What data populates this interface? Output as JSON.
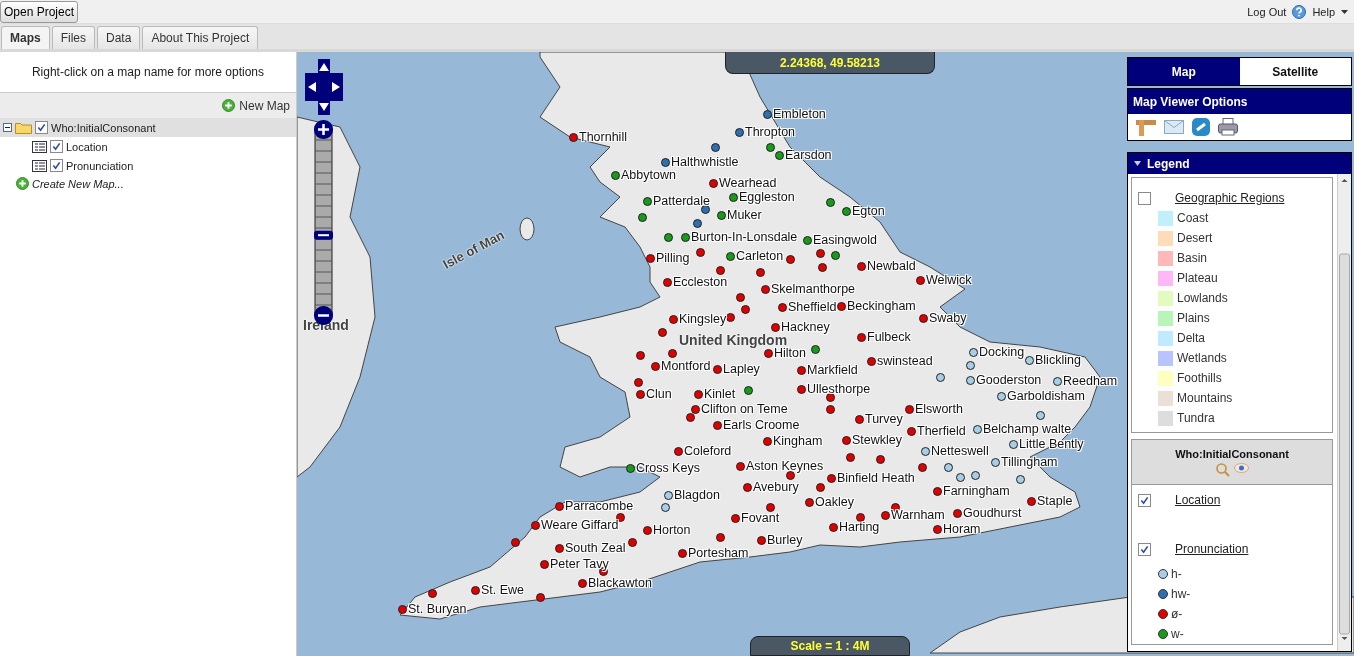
{
  "top_bar": {
    "open_button": "Open Project",
    "logout": "Log Out",
    "help": "Help"
  },
  "tabs": [
    {
      "label": "Maps",
      "selected": true
    },
    {
      "label": "Files",
      "selected": false
    },
    {
      "label": "Data",
      "selected": false
    },
    {
      "label": "About This Project",
      "selected": false
    }
  ],
  "left_panel": {
    "hint": "Right-click on a map name for more options",
    "new_map": "New Map",
    "tree": [
      {
        "label": "Who:InitialConsonant",
        "checked": true,
        "expanded": true,
        "children": [
          {
            "label": "Location",
            "checked": true
          },
          {
            "label": "Pronunciation",
            "checked": true
          }
        ]
      }
    ],
    "create_link": "Create New Map..."
  },
  "map": {
    "coordinates": "2.24368, 49.58213",
    "scale": "Scale = 1 : 4M",
    "zoom": {
      "level": 0.42
    },
    "region_labels": [
      {
        "label": "Isle of Man",
        "kind": "island"
      },
      {
        "label": "Ireland",
        "kind": "country"
      },
      {
        "label": "United Kingdom",
        "kind": "country"
      }
    ],
    "places": [
      {
        "name": "Thornhill",
        "color": "#e00000"
      },
      {
        "name": "Embleton",
        "color": "#2f6fae"
      },
      {
        "name": "Thropton",
        "color": "#2f6fae"
      },
      {
        "name": "Earsdon",
        "color": "#1a9a1a"
      },
      {
        "name": "Halthwhistle",
        "color": "#2f6fae"
      },
      {
        "name": "Abbytown",
        "color": "#1a9a1a"
      },
      {
        "name": "Wearhead",
        "color": "#e00000"
      },
      {
        "name": "Patterdale",
        "color": "#1a9a1a"
      },
      {
        "name": "Eggleston",
        "color": "#1a9a1a"
      },
      {
        "name": "Muker",
        "color": "#1a9a1a"
      },
      {
        "name": "Egton",
        "color": "#1a9a1a"
      },
      {
        "name": "Burton-In-Lonsdale",
        "color": "#1a9a1a"
      },
      {
        "name": "Easingwold",
        "color": "#1a9a1a"
      },
      {
        "name": "Pilling",
        "color": "#e00000"
      },
      {
        "name": "Carleton",
        "color": "#1a9a1a"
      },
      {
        "name": "Newbald",
        "color": "#e00000"
      },
      {
        "name": "Welwick",
        "color": "#e00000"
      },
      {
        "name": "Eccleston",
        "color": "#e00000"
      },
      {
        "name": "Skelmanthorpe",
        "color": "#e00000"
      },
      {
        "name": "Sheffield",
        "color": "#e00000"
      },
      {
        "name": "Beckingham",
        "color": "#e00000"
      },
      {
        "name": "Swaby",
        "color": "#e00000"
      },
      {
        "name": "Kingsley",
        "color": "#e00000"
      },
      {
        "name": "Hackney",
        "color": "#e00000"
      },
      {
        "name": "Fulbeck",
        "color": "#e00000"
      },
      {
        "name": "Hilton",
        "color": "#e00000"
      },
      {
        "name": "Montford",
        "color": "#e00000"
      },
      {
        "name": "Lapley",
        "color": "#e00000"
      },
      {
        "name": "Markfield",
        "color": "#e00000"
      },
      {
        "name": "swinstead",
        "color": "#e00000"
      },
      {
        "name": "Docking",
        "color": "#a8cde6"
      },
      {
        "name": "Blickling",
        "color": "#a8cde6"
      },
      {
        "name": "Gooderston",
        "color": "#a8cde6"
      },
      {
        "name": "Reedham",
        "color": "#a8cde6"
      },
      {
        "name": "Clun",
        "color": "#e00000"
      },
      {
        "name": "Kinlet",
        "color": "#e00000"
      },
      {
        "name": "Ullesthorpe",
        "color": "#e00000"
      },
      {
        "name": "Garboldisham",
        "color": "#a8cde6"
      },
      {
        "name": "Clifton on Teme",
        "color": "#e00000"
      },
      {
        "name": "Elsworth",
        "color": "#e00000"
      },
      {
        "name": "Turvey",
        "color": "#e00000"
      },
      {
        "name": "Earls Croome",
        "color": "#e00000"
      },
      {
        "name": "Therfield",
        "color": "#e00000"
      },
      {
        "name": "Belchamp walte",
        "color": "#a8cde6"
      },
      {
        "name": "Kingham",
        "color": "#e00000"
      },
      {
        "name": "Stewkley",
        "color": "#e00000"
      },
      {
        "name": "Little Bently",
        "color": "#a8cde6"
      },
      {
        "name": "Netteswell",
        "color": "#a8cde6"
      },
      {
        "name": "Tillingham",
        "color": "#a8cde6"
      },
      {
        "name": "Coleford",
        "color": "#e00000"
      },
      {
        "name": "Cross Keys",
        "color": "#1a9a1a"
      },
      {
        "name": "Aston Keynes",
        "color": "#e00000"
      },
      {
        "name": "Binfield Heath",
        "color": "#e00000"
      },
      {
        "name": "Avebury",
        "color": "#e00000"
      },
      {
        "name": "Farningham",
        "color": "#e00000"
      },
      {
        "name": "Parracombe",
        "color": "#e00000"
      },
      {
        "name": "Blagdon",
        "color": "#a8cde6"
      },
      {
        "name": "Oakley",
        "color": "#e00000"
      },
      {
        "name": "Staple",
        "color": "#e00000"
      },
      {
        "name": "Weare Giffard",
        "color": "#e00000"
      },
      {
        "name": "Fovant",
        "color": "#e00000"
      },
      {
        "name": "Warnham",
        "color": "#e00000"
      },
      {
        "name": "Goudhurst",
        "color": "#e00000"
      },
      {
        "name": "Horton",
        "color": "#e00000"
      },
      {
        "name": "Harting",
        "color": "#e00000"
      },
      {
        "name": "Horam",
        "color": "#e00000"
      },
      {
        "name": "South Zeal",
        "color": "#e00000"
      },
      {
        "name": "Portesham",
        "color": "#e00000"
      },
      {
        "name": "Burley",
        "color": "#e00000"
      },
      {
        "name": "Peter Tavy",
        "color": "#e00000"
      },
      {
        "name": "Blackawton",
        "color": "#e00000"
      },
      {
        "name": "St. Ewe",
        "color": "#e00000"
      },
      {
        "name": "St. Buryan",
        "color": "#e00000"
      }
    ],
    "points": [
      {
        "color": "#1a9a1a"
      },
      {
        "color": "#1a9a1a"
      },
      {
        "color": "#e00000"
      },
      {
        "color": "#e00000"
      },
      {
        "color": "#e00000"
      },
      {
        "color": "#e00000"
      },
      {
        "color": "#e00000"
      },
      {
        "color": "#e00000"
      },
      {
        "color": "#e00000"
      },
      {
        "color": "#e00000"
      },
      {
        "color": "#e00000"
      },
      {
        "color": "#e00000"
      },
      {
        "color": "#e00000"
      },
      {
        "color": "#e00000"
      },
      {
        "color": "#e00000"
      },
      {
        "color": "#e00000"
      },
      {
        "color": "#1a9a1a"
      },
      {
        "color": "#e00000"
      },
      {
        "color": "#1a9a1a"
      },
      {
        "color": "#e00000"
      },
      {
        "color": "#e00000"
      },
      {
        "color": "#e00000"
      },
      {
        "color": "#e00000"
      },
      {
        "color": "#e00000"
      },
      {
        "color": "#e00000"
      },
      {
        "color": "#e00000"
      },
      {
        "color": "#e00000"
      },
      {
        "color": "#e00000"
      },
      {
        "color": "#e00000"
      },
      {
        "color": "#e00000"
      },
      {
        "color": "#e00000"
      },
      {
        "color": "#e00000"
      },
      {
        "color": "#e00000"
      },
      {
        "color": "#a8cde6"
      },
      {
        "color": "#a8cde6"
      },
      {
        "color": "#a8cde6"
      },
      {
        "color": "#a8cde6"
      },
      {
        "color": "#a8cde6"
      },
      {
        "color": "#a8cde6"
      },
      {
        "color": "#a8cde6"
      },
      {
        "color": "#a8cde6"
      },
      {
        "color": "#e00000"
      },
      {
        "color": "#e00000"
      },
      {
        "color": "#1a9a1a"
      },
      {
        "color": "#1a9a1a"
      },
      {
        "color": "#2f6fae"
      },
      {
        "color": "#2f6fae"
      },
      {
        "color": "#2f6fae"
      },
      {
        "color": "#1a9a1a"
      }
    ]
  },
  "right_panel": {
    "map_types": [
      {
        "label": "Map",
        "selected": true
      },
      {
        "label": "Satellite",
        "selected": false
      }
    ],
    "options_title": "Map Viewer Options",
    "legend": {
      "title": "Legend",
      "expanded": true,
      "regions_layer": {
        "label": "Geographic Regions",
        "checked": false
      },
      "regions": [
        {
          "label": "Coast",
          "color": "#bff0fb"
        },
        {
          "label": "Desert",
          "color": "#ffdcb8"
        },
        {
          "label": "Basin",
          "color": "#ffb8b8"
        },
        {
          "label": "Plateau",
          "color": "#ffb8f5"
        },
        {
          "label": "Lowlands",
          "color": "#e2fcc0"
        },
        {
          "label": "Plains",
          "color": "#b8f5b8"
        },
        {
          "label": "Delta",
          "color": "#bfeaff"
        },
        {
          "label": "Wetlands",
          "color": "#b8c4ff"
        },
        {
          "label": "Foothills",
          "color": "#ffffc0"
        },
        {
          "label": "Mountains",
          "color": "#eae0d8"
        },
        {
          "label": "Tundra",
          "color": "#dddddd"
        }
      ],
      "layer_title": "Who:InitialConsonant",
      "layers": [
        {
          "label": "Location",
          "checked": true
        },
        {
          "label": "Pronunciation",
          "checked": true
        }
      ],
      "categories": [
        {
          "label": "h-",
          "color": "#a8cde6"
        },
        {
          "label": "hw-",
          "color": "#2f6fae"
        },
        {
          "label": "ø-",
          "color": "#e00000"
        },
        {
          "label": "w-",
          "color": "#1a9a1a"
        }
      ]
    }
  }
}
